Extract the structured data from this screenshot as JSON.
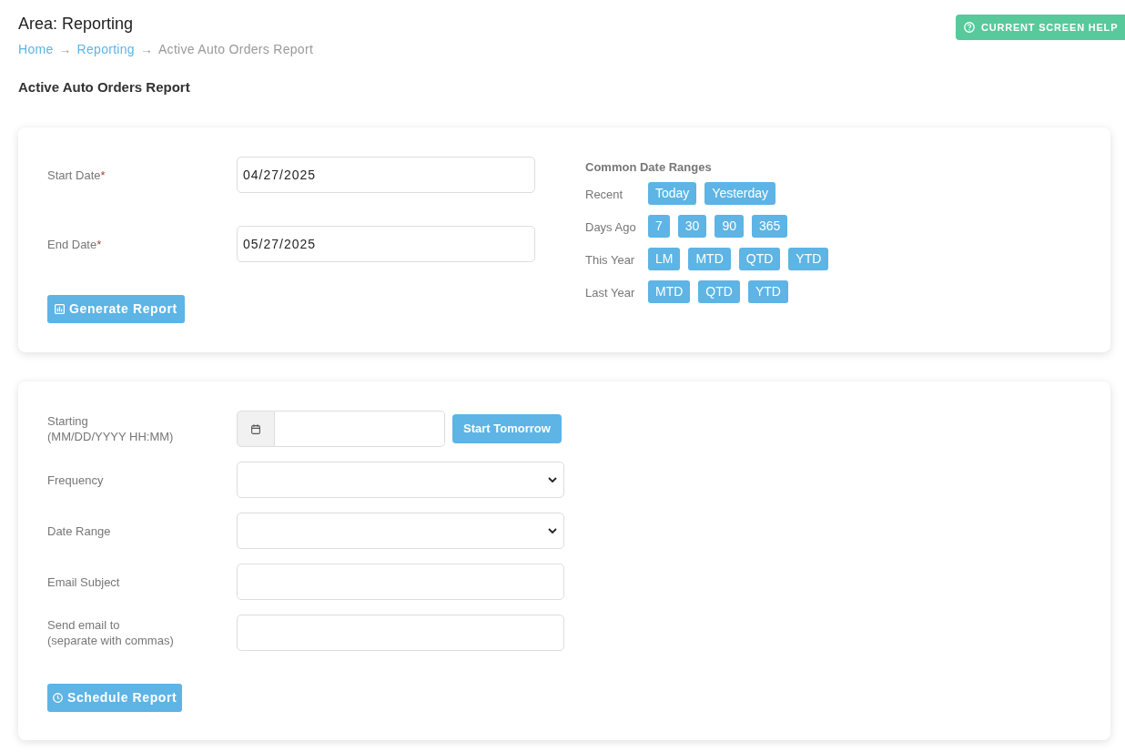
{
  "header": {
    "area_title": "Area: Reporting",
    "help_button": "CURRENT SCREEN HELP",
    "breadcrumb": [
      {
        "kind": "link",
        "label": "Home"
      },
      {
        "kind": "separator",
        "label": "→"
      },
      {
        "kind": "link",
        "label": "Reporting"
      },
      {
        "kind": "separator",
        "label": "→"
      },
      {
        "kind": "current",
        "label": "Active Auto Orders Report"
      }
    ],
    "page_title": "Active Auto Orders Report"
  },
  "report_form": {
    "fields": [
      {
        "label": "Start Date",
        "required_mark": "*",
        "value": "04/27/2025"
      },
      {
        "label": "End Date",
        "required_mark": "*",
        "value": "05/27/2025"
      }
    ],
    "generate_button": "Generate Report",
    "date_ranges": {
      "title": "Common Date Ranges",
      "groups": [
        {
          "label": "Recent",
          "options": [
            "Today",
            "Yesterday"
          ]
        },
        {
          "label": "Days Ago",
          "options": [
            "7",
            "30",
            "90",
            "365"
          ]
        },
        {
          "label": "This Year",
          "options": [
            "LM",
            "MTD",
            "QTD",
            "YTD"
          ]
        },
        {
          "label": "Last Year",
          "options": [
            "MTD",
            "QTD",
            "YTD"
          ]
        }
      ]
    }
  },
  "schedule_form": {
    "rows": [
      {
        "kind": "datetime",
        "label": "Starting",
        "hint": "(MM/DD/YYYY HH:MM)",
        "button": "Start Tomorrow"
      },
      {
        "kind": "select",
        "label": "Frequency"
      },
      {
        "kind": "select",
        "label": "Date Range"
      },
      {
        "kind": "text",
        "label": "Email Subject"
      },
      {
        "kind": "text",
        "label": "Send email to",
        "hint": "(separate with commas)"
      }
    ],
    "schedule_button": "Schedule Report"
  }
}
